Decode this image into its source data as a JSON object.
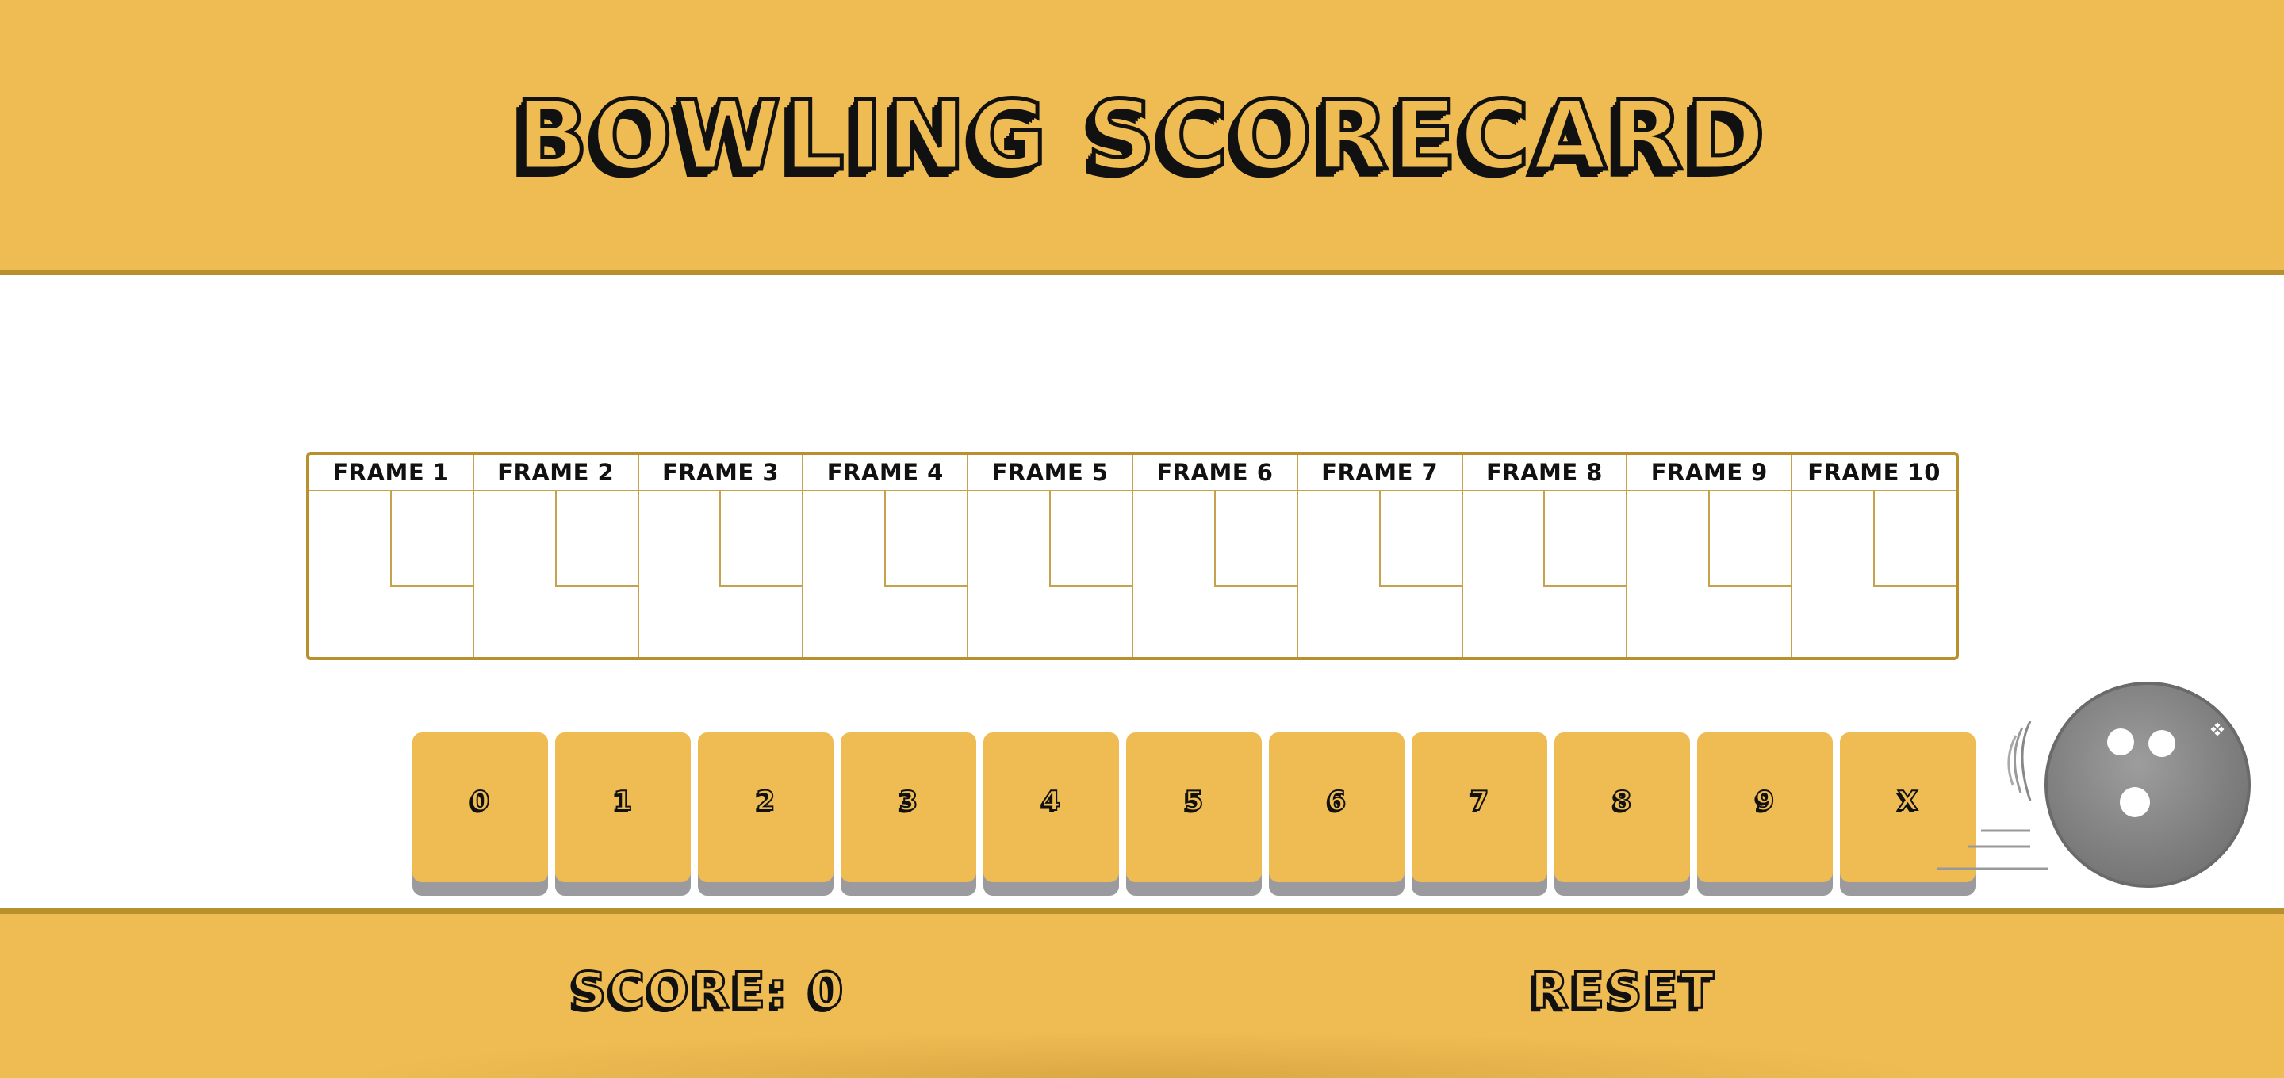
{
  "header": {
    "title": "BOWLING SCORECARD"
  },
  "scorecard": {
    "frames": [
      {
        "label": "FRAME 1"
      },
      {
        "label": "FRAME 2"
      },
      {
        "label": "FRAME 3"
      },
      {
        "label": "FRAME 4"
      },
      {
        "label": "FRAME 5"
      },
      {
        "label": "FRAME 6"
      },
      {
        "label": "FRAME 7"
      },
      {
        "label": "FRAME 8"
      },
      {
        "label": "FRAME 9"
      },
      {
        "label": "FRAME 10"
      }
    ]
  },
  "pin_buttons": [
    {
      "label": "0"
    },
    {
      "label": "1"
    },
    {
      "label": "2"
    },
    {
      "label": "3"
    },
    {
      "label": "4"
    },
    {
      "label": "5"
    },
    {
      "label": "6"
    },
    {
      "label": "7"
    },
    {
      "label": "8"
    },
    {
      "label": "9"
    },
    {
      "label": "X"
    }
  ],
  "footer": {
    "score_label": "SCORE: 0",
    "reset_label": "RESET"
  },
  "colors": {
    "accent": "#efbc53",
    "border": "#b8912e",
    "button_shadow": "#9b9b9f",
    "ball": "#8a8a8a"
  },
  "icons": {
    "ball": "bowling-ball-icon"
  }
}
